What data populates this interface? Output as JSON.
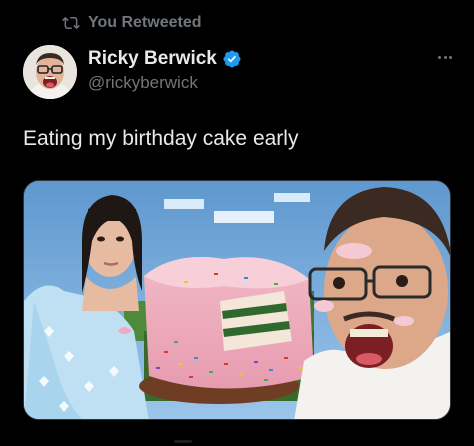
{
  "retweet": {
    "label": "You Retweeted",
    "icon": "retweet-icon"
  },
  "author": {
    "display_name": "Ricky Berwick",
    "handle": "@rickyberwick",
    "verified": true,
    "verified_color": "#1d9bf0",
    "avatar_icon": "avatar"
  },
  "tweet": {
    "text": "Eating my birthday cake early"
  },
  "media": {
    "kind": "photo",
    "icon": "photo-image"
  },
  "more": {
    "icon": "more-options-icon"
  },
  "colors": {
    "background": "#000000",
    "primary_text": "#e7e9ea",
    "secondary_text": "#71767b",
    "border": "#2f3336"
  }
}
